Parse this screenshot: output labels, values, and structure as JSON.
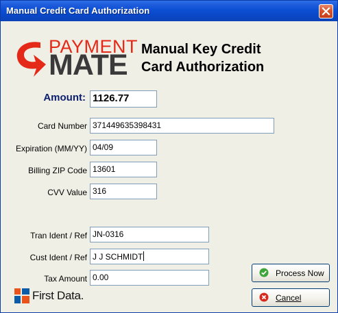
{
  "window": {
    "title": "Manual Credit Card Authorization"
  },
  "logo": {
    "payment": "PAYMENT",
    "mate": "MATE"
  },
  "heading": {
    "line1": "Manual Key Credit",
    "line2": "Card Authorization"
  },
  "form": {
    "amount_label": "Amount:",
    "amount_value": "1126.77",
    "card_label": "Card Number",
    "card_value": "371449635398431",
    "exp_label": "Expiration (MM/YY)",
    "exp_value": "04/09",
    "zip_label": "Billing ZIP Code",
    "zip_value": "13601",
    "cvv_label": "CVV Value",
    "cvv_value": "316",
    "tran_label": "Tran Ident / Ref",
    "tran_value": "JN-0316",
    "cust_label": "Cust Ident / Ref",
    "cust_value": "J J SCHMIDT",
    "tax_label": "Tax Amount",
    "tax_value": "0.00"
  },
  "buttons": {
    "process": "Process Now",
    "cancel": "Cancel"
  },
  "footer": {
    "brand": "First Data."
  },
  "colors": {
    "titlebar": "#0a48c8",
    "accent_red": "#e42918",
    "label_blue": "#0a1e6e",
    "check_green": "#3fa53a",
    "cancel_red": "#d62a1e"
  }
}
